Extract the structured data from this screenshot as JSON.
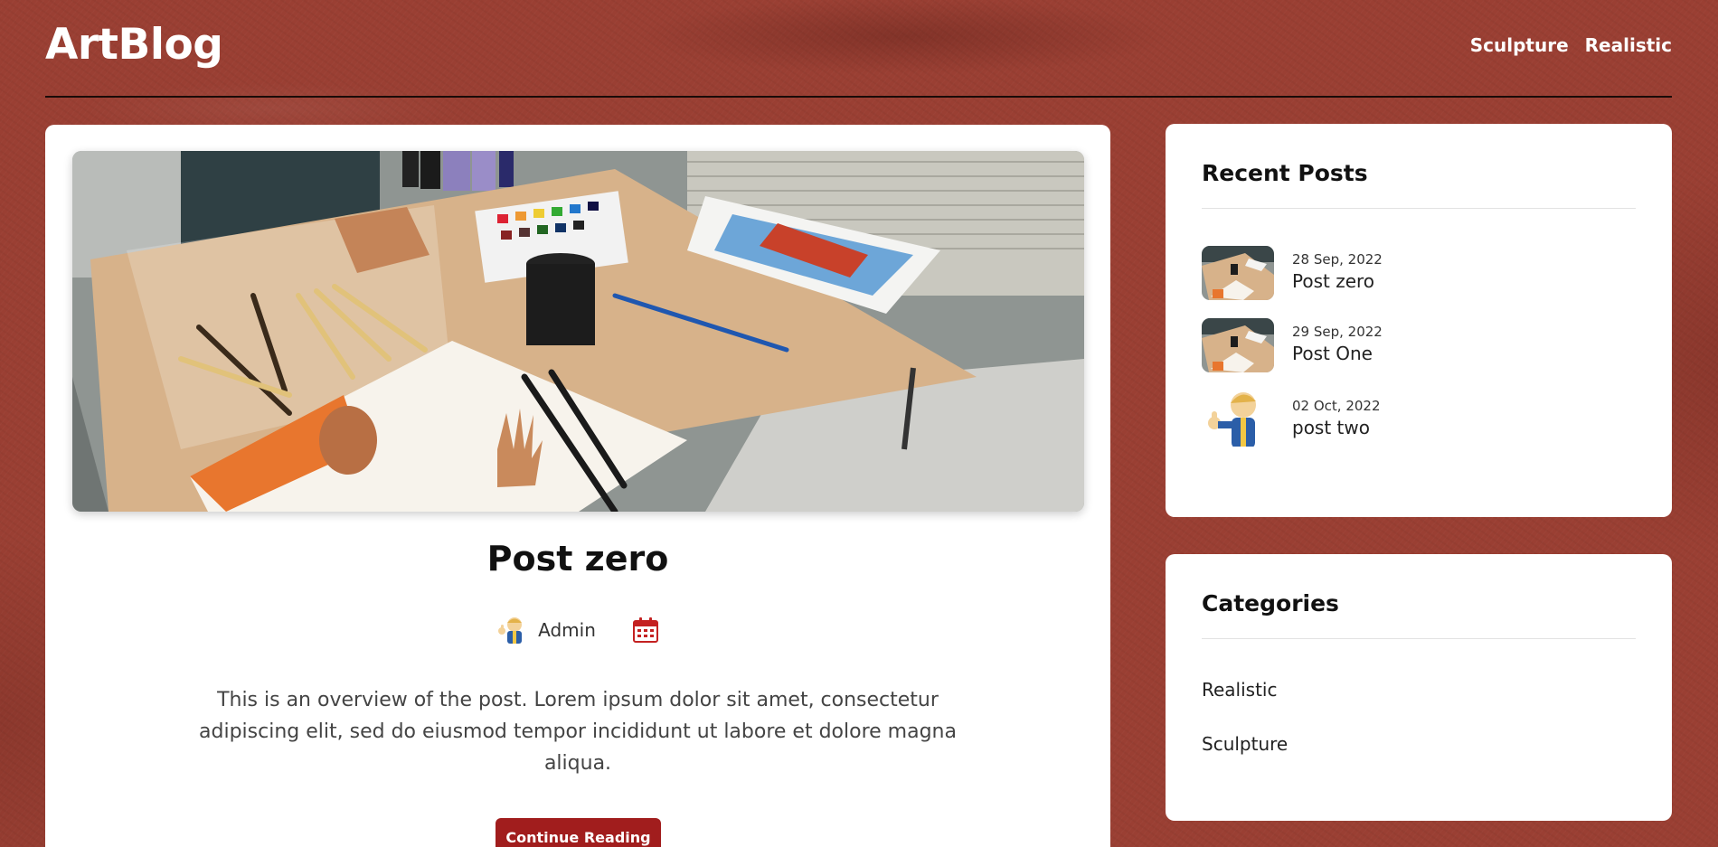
{
  "header": {
    "logo": "ArtBlog",
    "nav": [
      {
        "label": "Sculpture"
      },
      {
        "label": "Realistic"
      }
    ]
  },
  "main": {
    "post_title": "Post zero",
    "author": "Admin",
    "excerpt": "This is an overview of the post. Lorem ipsum dolor sit amet, consectetur adipiscing elit, sed do eiusmod tempor incididunt ut labore et dolore magna aliqua.",
    "cta_label": "Continue Reading"
  },
  "sidebar": {
    "recent_title": "Recent Posts",
    "recent_posts": [
      {
        "date": "28 Sep, 2022",
        "title": "Post zero",
        "thumb": "art-desk-photo"
      },
      {
        "date": "29 Sep, 2022",
        "title": "Post One",
        "thumb": "art-desk-photo"
      },
      {
        "date": "02 Oct, 2022",
        "title": "post two",
        "thumb": "thumbs-up-mascot"
      }
    ],
    "categories_title": "Categories",
    "categories": [
      {
        "label": "Realistic"
      },
      {
        "label": "Sculpture"
      }
    ]
  },
  "colors": {
    "background": "#9a3f33",
    "accent": "#a11d1d",
    "card": "#ffffff"
  },
  "icons": {
    "calendar": "calendar-icon",
    "author": "author-avatar"
  }
}
